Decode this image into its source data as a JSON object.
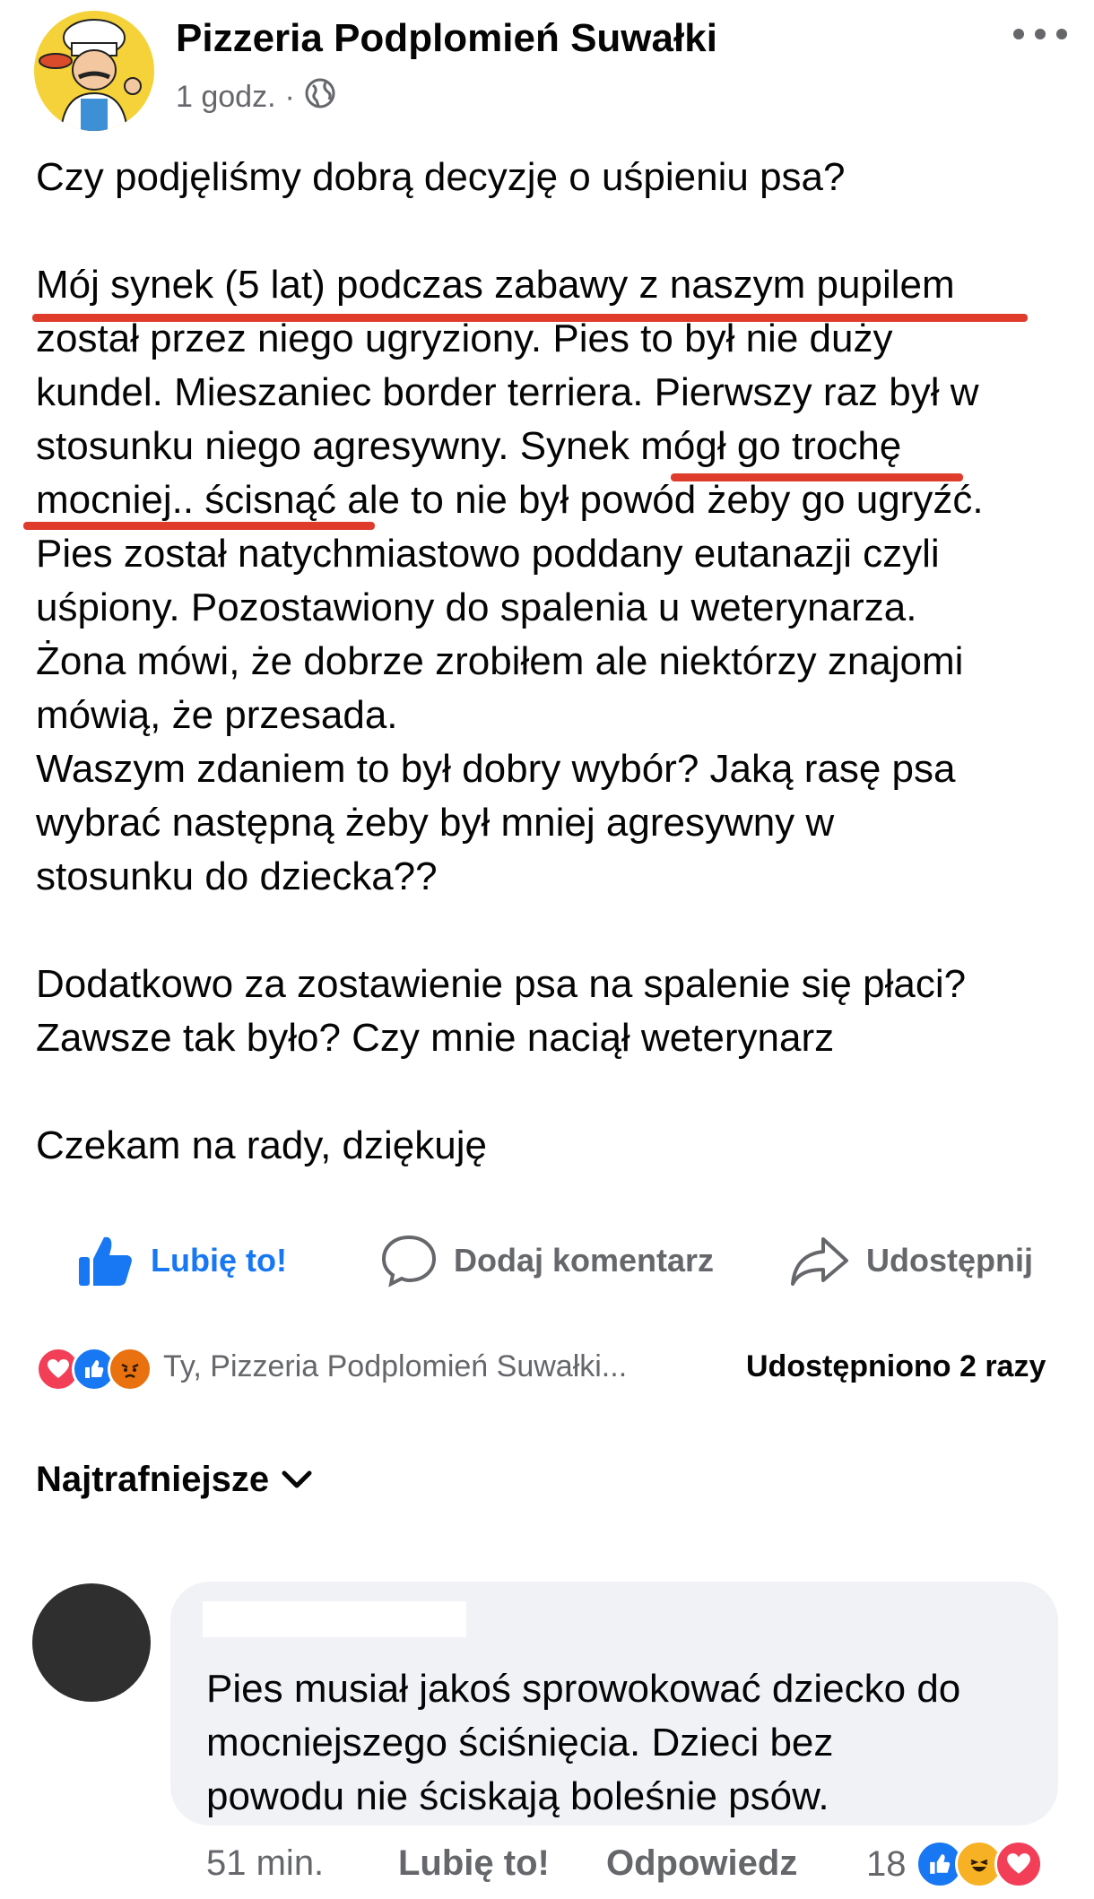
{
  "post": {
    "author": "Pizzeria Podplomień Suwałki",
    "time": "1 godz.",
    "separator": "·",
    "paragraphs": [
      "Czy podjęliśmy dobrą decyzję o uśpieniu psa?",
      "",
      "Mój synek (5 lat) podczas zabawy z naszym pupilem",
      "został przez niego ugryziony. Pies to był nie duży",
      "kundel. Mieszaniec border terriera. Pierwszy raz był w",
      "stosunku niego agresywny. Synek mógł go trochę",
      "mocniej.. ścisnąć ale to nie był powód żeby go ugryźć.",
      "Pies został natychmiastowo poddany eutanazji czyli",
      "uśpiony. Pozostawiony do spalenia u weterynarza.",
      "Żona mówi, że dobrze zrobiłem ale niektórzy znajomi",
      "mówią, że przesada.",
      "Waszym zdaniem to był dobry wybór? Jaką rasę psa",
      "wybrać następną żeby był mniej agresywny w",
      "stosunku do dziecka??",
      "",
      "Dodatkowo za zostawienie psa na spalenie się płaci?",
      "Zawsze tak było? Czy mnie naciął weterynarz",
      "",
      "Czekam na rady, dziękuję"
    ]
  },
  "actions": {
    "like": "Lubię to!",
    "comment": "Dodaj komentarz",
    "share": "Udostępnij"
  },
  "reactions": {
    "names": "Ty, Pizzeria Podplomień Suwałki...",
    "shares": "Udostępniono 2 razy",
    "icons": [
      "love-icon",
      "like-icon",
      "angry-icon"
    ]
  },
  "sort_label": "Najtrafniejsze",
  "comment": {
    "text_lines": [
      "Pies musiał jakoś sprowokować dziecko do",
      "mocniejszego ściśnięcia. Dzieci bez",
      "powodu nie ściskają boleśnie psów."
    ],
    "time": "51 min.",
    "like": "Lubię to!",
    "reply": "Odpowiedz",
    "reaction_count": "18",
    "reaction_icons": [
      "like-icon",
      "haha-icon",
      "love-icon"
    ]
  },
  "colors": {
    "accent_blue": "#1877f2",
    "annotation_red": "#e03c2c",
    "muted_text": "#65676b"
  }
}
